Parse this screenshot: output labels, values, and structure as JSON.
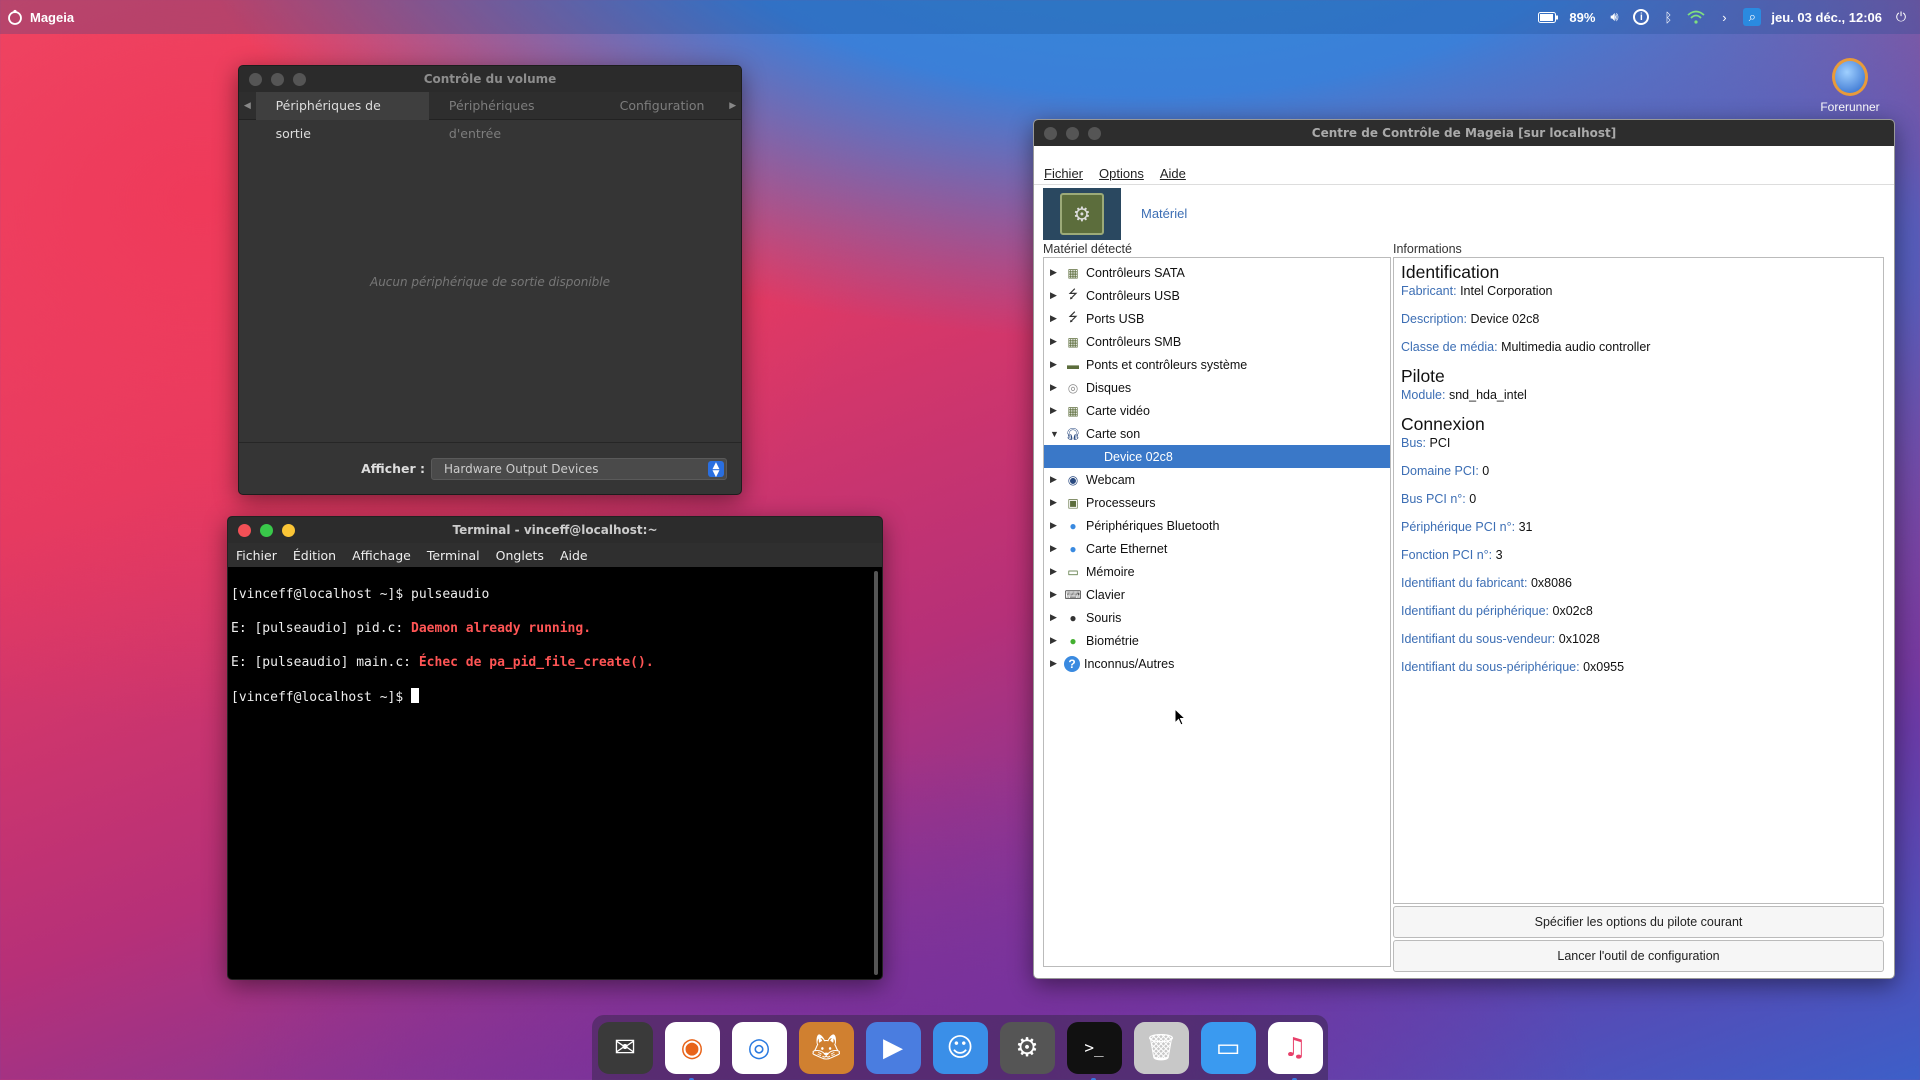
{
  "topbar": {
    "app_name": "Mageia",
    "battery": "89%",
    "datetime": "jeu. 03 déc., 12:06",
    "icons": [
      "battery-icon",
      "volume-icon",
      "info-icon",
      "bluetooth-icon",
      "wifi-icon",
      "chevron-right-icon",
      "search-icon",
      "power-icon"
    ]
  },
  "desktop_icon": {
    "label": "Forerunner"
  },
  "volume": {
    "title": "Contrôle du volume",
    "tabs": [
      "Périphériques de sortie",
      "Périphériques d'entrée",
      "Configuration"
    ],
    "empty_message": "Aucun périphérique de sortie disponible",
    "show_label": "Afficher :",
    "show_value": "Hardware Output Devices"
  },
  "terminal": {
    "title": "Terminal - vinceff@localhost:~",
    "menu": [
      "Fichier",
      "Édition",
      "Affichage",
      "Terminal",
      "Onglets",
      "Aide"
    ],
    "lines": [
      {
        "plain": "[vinceff@localhost ~]$ pulseaudio",
        "red": ""
      },
      {
        "plain": "E: [pulseaudio] pid.c: ",
        "red": "Daemon already running."
      },
      {
        "plain": "E: [pulseaudio] main.c: ",
        "red": "Échec de pa_pid_file_create()."
      },
      {
        "plain": "[vinceff@localhost ~]$ ",
        "red": ""
      }
    ]
  },
  "mcc": {
    "title": "Centre de Contrôle de Mageia  [sur localhost]",
    "menu": [
      "Fichier",
      "Options",
      "Aide"
    ],
    "section_label": "Matériel",
    "left_caption": "Matériel détecté",
    "right_caption": "Informations",
    "tree": [
      {
        "label": "Contrôleurs SATA",
        "icon": "chip-icon",
        "expanded": false
      },
      {
        "label": "Contrôleurs USB",
        "icon": "usb-icon",
        "expanded": false
      },
      {
        "label": "Ports USB",
        "icon": "usb-icon",
        "expanded": false
      },
      {
        "label": "Contrôleurs SMB",
        "icon": "chip-icon",
        "expanded": false
      },
      {
        "label": "Ponts et contrôleurs système",
        "icon": "bridge-icon",
        "expanded": false
      },
      {
        "label": "Disques",
        "icon": "disk-icon",
        "expanded": false
      },
      {
        "label": "Carte vidéo",
        "icon": "chip-icon",
        "expanded": false
      },
      {
        "label": "Carte son",
        "icon": "headphones-icon",
        "expanded": true
      },
      {
        "label": "Device 02c8",
        "icon": "",
        "child": true
      },
      {
        "label": "Webcam",
        "icon": "webcam-icon",
        "expanded": false
      },
      {
        "label": "Processeurs",
        "icon": "cpu-icon",
        "expanded": false
      },
      {
        "label": "Périphériques Bluetooth",
        "icon": "globe-icon",
        "expanded": false
      },
      {
        "label": "Carte Ethernet",
        "icon": "globe-icon",
        "expanded": false
      },
      {
        "label": "Mémoire",
        "icon": "memory-icon",
        "expanded": false
      },
      {
        "label": "Clavier",
        "icon": "keyboard-icon",
        "expanded": false
      },
      {
        "label": "Souris",
        "icon": "mouse-icon",
        "expanded": false
      },
      {
        "label": "Biométrie",
        "icon": "biometric-icon",
        "expanded": false
      },
      {
        "label": "Inconnus/Autres",
        "icon": "question-icon",
        "expanded": false
      }
    ],
    "info": {
      "identification": {
        "heading": "Identification",
        "rows": [
          [
            "Fabricant:",
            "Intel Corporation"
          ],
          [
            "Description:",
            "Device 02c8"
          ],
          [
            "Classe de média:",
            "Multimedia audio controller"
          ]
        ]
      },
      "pilote": {
        "heading": "Pilote",
        "rows": [
          [
            "Module:",
            "snd_hda_intel"
          ]
        ]
      },
      "connexion": {
        "heading": "Connexion",
        "rows": [
          [
            "Bus:",
            "PCI"
          ],
          [
            "Domaine PCI:",
            "0"
          ],
          [
            "Bus PCI n°:",
            "0"
          ],
          [
            "Périphérique PCI n°:",
            "31"
          ],
          [
            "Fonction PCI n°:",
            "3"
          ],
          [
            "Identifiant du fabricant:",
            "0x8086"
          ],
          [
            "Identifiant du périphérique:",
            "0x02c8"
          ],
          [
            "Identifiant du sous-vendeur:",
            "0x1028"
          ],
          [
            "Identifiant du sous-périphérique:",
            "0x0955"
          ]
        ]
      }
    },
    "buttons": [
      "Spécifier les options du pilote courant",
      "Lancer l'outil de configuration"
    ]
  },
  "dock": [
    {
      "name": "mail-icon",
      "color": "#3a3a3a"
    },
    {
      "name": "firefox-icon",
      "color": "#ffffff"
    },
    {
      "name": "browser-icon",
      "color": "#ffffff"
    },
    {
      "name": "gimp-icon",
      "color": "#d08030"
    },
    {
      "name": "video-call-icon",
      "color": "#4a7de0"
    },
    {
      "name": "finder-icon",
      "color": "#3a8fe8"
    },
    {
      "name": "settings-icon",
      "color": "#555555"
    },
    {
      "name": "terminal-icon",
      "color": "#111111"
    },
    {
      "name": "trash-icon",
      "color": "#c8c8c8"
    },
    {
      "name": "files-icon",
      "color": "#3a9af0"
    },
    {
      "name": "music-icon",
      "color": "#ffffff"
    }
  ]
}
